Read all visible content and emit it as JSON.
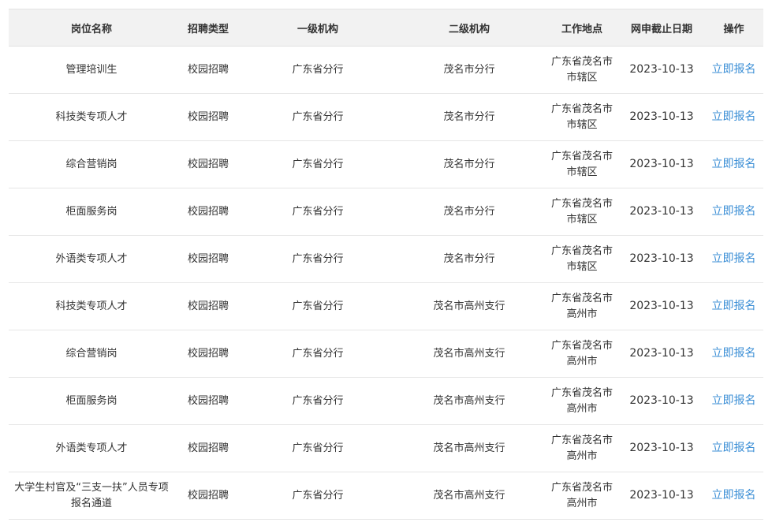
{
  "table": {
    "headers": [
      "岗位名称",
      "招聘类型",
      "一级机构",
      "二级机构",
      "工作地点",
      "网申截止日期",
      "操作"
    ],
    "rows": [
      {
        "name": "管理培训生",
        "type": "校园招聘",
        "org1": "广东省分行",
        "org2": "茂名市分行",
        "location": "广东省茂名市市辖区",
        "deadline": "2023-10-13",
        "action": "立即报名"
      },
      {
        "name": "科技类专项人才",
        "type": "校园招聘",
        "org1": "广东省分行",
        "org2": "茂名市分行",
        "location": "广东省茂名市市辖区",
        "deadline": "2023-10-13",
        "action": "立即报名"
      },
      {
        "name": "综合营销岗",
        "type": "校园招聘",
        "org1": "广东省分行",
        "org2": "茂名市分行",
        "location": "广东省茂名市市辖区",
        "deadline": "2023-10-13",
        "action": "立即报名"
      },
      {
        "name": "柜面服务岗",
        "type": "校园招聘",
        "org1": "广东省分行",
        "org2": "茂名市分行",
        "location": "广东省茂名市市辖区",
        "deadline": "2023-10-13",
        "action": "立即报名"
      },
      {
        "name": "外语类专项人才",
        "type": "校园招聘",
        "org1": "广东省分行",
        "org2": "茂名市分行",
        "location": "广东省茂名市市辖区",
        "deadline": "2023-10-13",
        "action": "立即报名"
      },
      {
        "name": "科技类专项人才",
        "type": "校园招聘",
        "org1": "广东省分行",
        "org2": "茂名市高州支行",
        "location": "广东省茂名市高州市",
        "deadline": "2023-10-13",
        "action": "立即报名"
      },
      {
        "name": "综合营销岗",
        "type": "校园招聘",
        "org1": "广东省分行",
        "org2": "茂名市高州支行",
        "location": "广东省茂名市高州市",
        "deadline": "2023-10-13",
        "action": "立即报名"
      },
      {
        "name": "柜面服务岗",
        "type": "校园招聘",
        "org1": "广东省分行",
        "org2": "茂名市高州支行",
        "location": "广东省茂名市高州市",
        "deadline": "2023-10-13",
        "action": "立即报名"
      },
      {
        "name": "外语类专项人才",
        "type": "校园招聘",
        "org1": "广东省分行",
        "org2": "茂名市高州支行",
        "location": "广东省茂名市高州市",
        "deadline": "2023-10-13",
        "action": "立即报名"
      },
      {
        "name": "大学生村官及“三支一扶”人员专项报名通道",
        "type": "校园招聘",
        "org1": "广东省分行",
        "org2": "茂名市高州支行",
        "location": "广东省茂名市高州市",
        "deadline": "2023-10-13",
        "action": "立即报名"
      }
    ]
  },
  "colors": {
    "header_bg": "#f2f2f2",
    "link": "#3c8fd6",
    "border": "#e6e6e6"
  }
}
